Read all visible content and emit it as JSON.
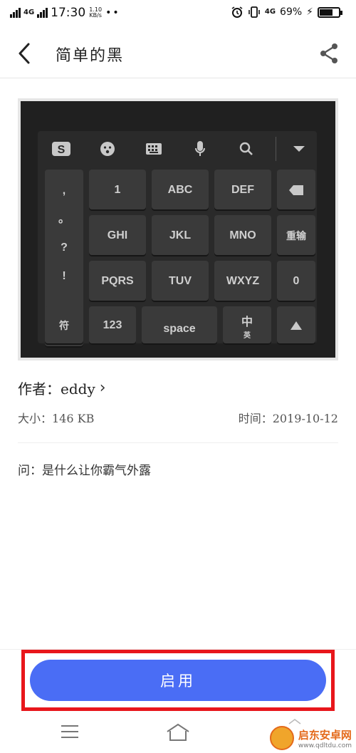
{
  "status_bar": {
    "network_left": "4G",
    "time": "17:30",
    "speed_value": "1.10",
    "speed_unit": "KB/s",
    "dots": "••",
    "network_right": "4G",
    "battery_pct": "69%",
    "battery_level": 0.69
  },
  "header": {
    "title": "简单的黑"
  },
  "keyboard_preview": {
    "toolbar_icons": [
      "sogou-logo-icon",
      "emoji-icon",
      "keyboard-icon",
      "microphone-icon",
      "search-icon",
      "collapse-icon"
    ],
    "symbol_column": [
      ",",
      "。",
      "?",
      "!"
    ],
    "keys_row1": [
      "1",
      "ABC",
      "DEF"
    ],
    "keys_row2": [
      "GHI",
      "JKL",
      "MNO"
    ],
    "keys_row3": [
      "PQRS",
      "TUV",
      "WXYZ"
    ],
    "delete_icon": "backspace-icon",
    "reinput": "重输",
    "zero": "0",
    "bottom_row": [
      "符",
      "123",
      "space",
      "中/英"
    ],
    "lang_main": "中",
    "lang_sub": "英",
    "enter_icon": "up-arrow-icon"
  },
  "info": {
    "author_label": "作者：eddy",
    "size_label": "大小：146 KB",
    "date_label": "时间：2019-10-12",
    "description": "问：是什么让你霸气外露"
  },
  "action": {
    "enable_label": "启用"
  },
  "watermark": {
    "name": "启东安卓网",
    "url": "www.qdltdu.com"
  },
  "colors": {
    "accent": "#4a6df5",
    "highlight": "#e8161b",
    "keyboard_bg": "#202020",
    "key_bg": "#3a3a3a"
  }
}
